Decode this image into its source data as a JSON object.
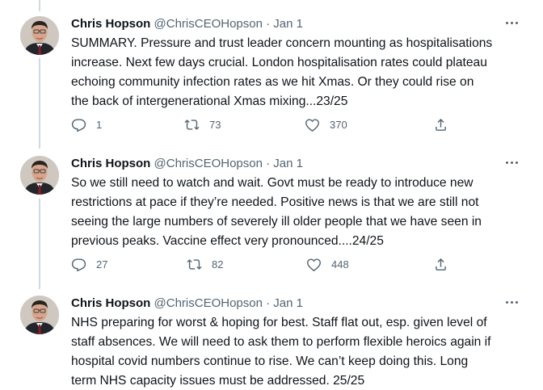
{
  "tweets": [
    {
      "name": "Chris Hopson",
      "handle": "@ChrisCEOHopson",
      "separator": "·",
      "date": "Jan 1",
      "text": "SUMMARY. Pressure and trust leader concern mounting as hospitalisations\nincrease. Next few days crucial. London hospitalisation rates could plateau\nechoing community infection rates as we hit Xmas. Or they could rise on\nthe back of intergenerational Xmas mixing...23/25",
      "replies": "1",
      "retweets": "73",
      "likes": "370"
    },
    {
      "name": "Chris Hopson",
      "handle": "@ChrisCEOHopson",
      "separator": "·",
      "date": "Jan 1",
      "text": "So we still need to watch and wait. Govt must be ready to introduce new\nrestrictions at pace if they’re needed. Positive news is that we are still not\nseeing the large numbers of severely ill older people that we have seen in\nprevious peaks. Vaccine effect very pronounced....24/25",
      "replies": "27",
      "retweets": "82",
      "likes": "448"
    },
    {
      "name": "Chris Hopson",
      "handle": "@ChrisCEOHopson",
      "separator": "·",
      "date": "Jan 1",
      "text": "NHS preparing for worst & hoping for best. Staff flat out, esp. given level of\nstaff absences. We will need to ask them to perform flexible heroics again if\nhospital covid numbers continue to rise. We can’t keep doing this. Long\nterm NHS capacity issues must be addressed. 25/25"
    }
  ],
  "icons": {
    "reply": "reply-icon",
    "retweet": "retweet-icon",
    "like": "heart-icon",
    "share": "share-icon",
    "more": "more-icon"
  },
  "colors": {
    "text": "#0f1419",
    "secondary": "#536471",
    "thread_line": "#cfd9de"
  }
}
